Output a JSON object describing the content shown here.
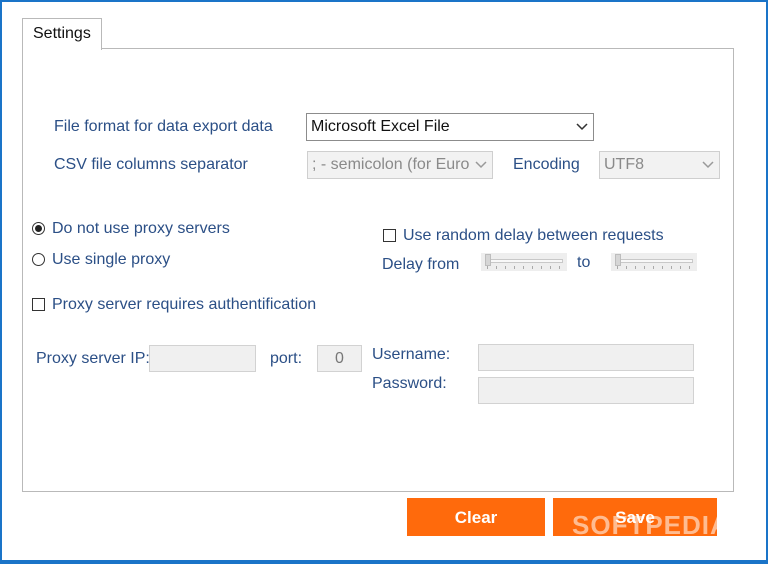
{
  "tabs": [
    {
      "label": "Settings"
    }
  ],
  "export": {
    "file_format_label": "File format for data export data",
    "file_format_value": "Microsoft Excel File",
    "csv_separator_label": "CSV file columns separator",
    "csv_separator_value": "; - semicolon (for Euro",
    "encoding_label": "Encoding",
    "encoding_value": "UTF8"
  },
  "proxy": {
    "no_proxy_label": "Do not use proxy servers",
    "no_proxy_selected": true,
    "single_proxy_label": "Use single proxy",
    "single_proxy_selected": false,
    "auth_label": "Proxy server requires authentification",
    "auth_checked": false,
    "ip_label": "Proxy server IP:",
    "ip_value": "",
    "port_label": "port:",
    "port_value": "0",
    "username_label": "Username:",
    "username_value": "",
    "password_label": "Password:",
    "password_value": ""
  },
  "delay": {
    "random_delay_label": "Use random delay between requests",
    "random_delay_checked": false,
    "from_label": "Delay from",
    "to_label": "to"
  },
  "buttons": {
    "clear_label": "Clear",
    "save_label": "Save"
  },
  "watermark": "SOFTPEDIA",
  "colors": {
    "accent": "#ff6a0c",
    "label_text": "#2b4f86",
    "window_border": "#1a74c8"
  }
}
